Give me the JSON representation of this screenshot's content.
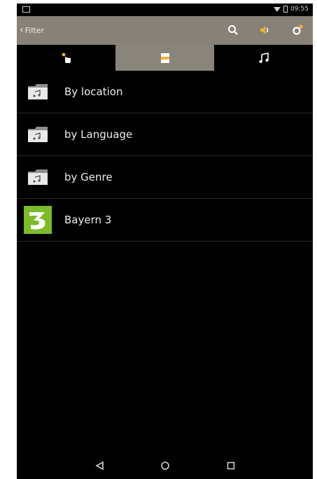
{
  "status_bar": {
    "time": "09:55"
  },
  "app_bar": {
    "back_label": "Filter"
  },
  "list": {
    "items": [
      {
        "label": "By location",
        "icon": "music-folder-icon"
      },
      {
        "label": "by Language",
        "icon": "music-folder-icon"
      },
      {
        "label": "by Genre",
        "icon": "music-folder-icon"
      },
      {
        "label": "Bayern 3",
        "icon": "bayern3-logo"
      }
    ]
  },
  "colors": {
    "app_bar": "#878177",
    "active_tab": "#8a857b",
    "background": "#000000",
    "accent": "#f2b233",
    "bayern_green": "#7dbb2a"
  }
}
